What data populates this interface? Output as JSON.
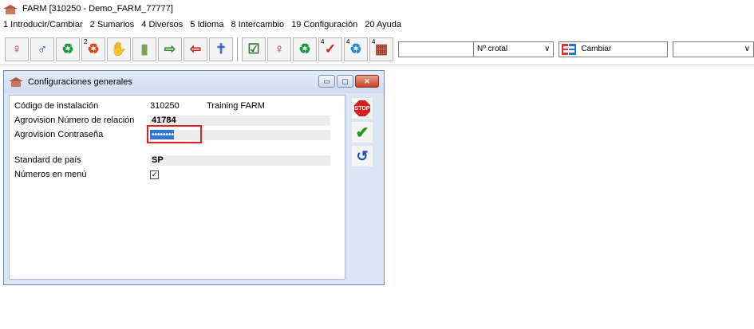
{
  "window": {
    "title": "FARM  [310250 - Demo_FARM_77777]"
  },
  "menu": {
    "items": [
      "1  Introducir/Cambiar",
      "2  Sumarios",
      "4  Diversos",
      "5  Idioma",
      "8  Intercambio",
      "19  Configuración",
      "20  Ayuda"
    ]
  },
  "toolbar": {
    "buttons": [
      {
        "icon": "female-symbol-icon",
        "glyph": "♀",
        "color": "#c8187a"
      },
      {
        "icon": "male-symbol-icon",
        "glyph": "♂",
        "color": "#1a4fb0"
      },
      {
        "icon": "recycle-icon",
        "glyph": "♻",
        "color": "#1a9a3a"
      },
      {
        "icon": "recycle-numbered-icon",
        "glyph": "♻",
        "color": "#d64a1a",
        "sub": "2"
      },
      {
        "icon": "animal-hand-icon",
        "glyph": "✋",
        "color": "#c8906a"
      },
      {
        "icon": "feed-bag-icon",
        "glyph": "▮",
        "color": "#7aa05a"
      },
      {
        "icon": "transfer-in-icon",
        "glyph": "⇨",
        "color": "#2a8a2a"
      },
      {
        "icon": "transfer-out-icon",
        "glyph": "⇦",
        "color": "#c82020"
      },
      {
        "icon": "death-icon",
        "glyph": "✝",
        "color": "#3a6ad0"
      },
      {
        "icon": "report-list-icon",
        "glyph": "☑",
        "color": "#3a7a3a"
      },
      {
        "icon": "female-report-icon",
        "glyph": "♀",
        "color": "#c8187a"
      },
      {
        "icon": "recycle-report-icon",
        "glyph": "♻",
        "color": "#1a9a3a"
      },
      {
        "icon": "graph-report-icon",
        "glyph": "✓",
        "color": "#c82020",
        "sub": "4"
      },
      {
        "icon": "animal-report-icon",
        "glyph": "♻",
        "color": "#2a8ad0",
        "sub": "4"
      },
      {
        "icon": "barn-report-icon",
        "glyph": "▦",
        "color": "#a0402a",
        "sub": "4"
      }
    ],
    "crotal_value": "",
    "crotal_select": "Nº crotal",
    "cambiar_label": "Cambiar",
    "right_select_value": ""
  },
  "dialog": {
    "title": "Configuraciones generales",
    "rows": [
      {
        "label": "Código de instalación",
        "value": "310250",
        "extra": "Training FARM"
      },
      {
        "label": "Agrovision Número de relación",
        "value": "41784"
      },
      {
        "label": "Agrovision Contraseña",
        "value": "••••••••"
      },
      {
        "label": "Standard de país",
        "value": "SP"
      },
      {
        "label": "Números en menú",
        "checked": true
      }
    ],
    "buttons": {
      "stop": "STOP"
    }
  }
}
